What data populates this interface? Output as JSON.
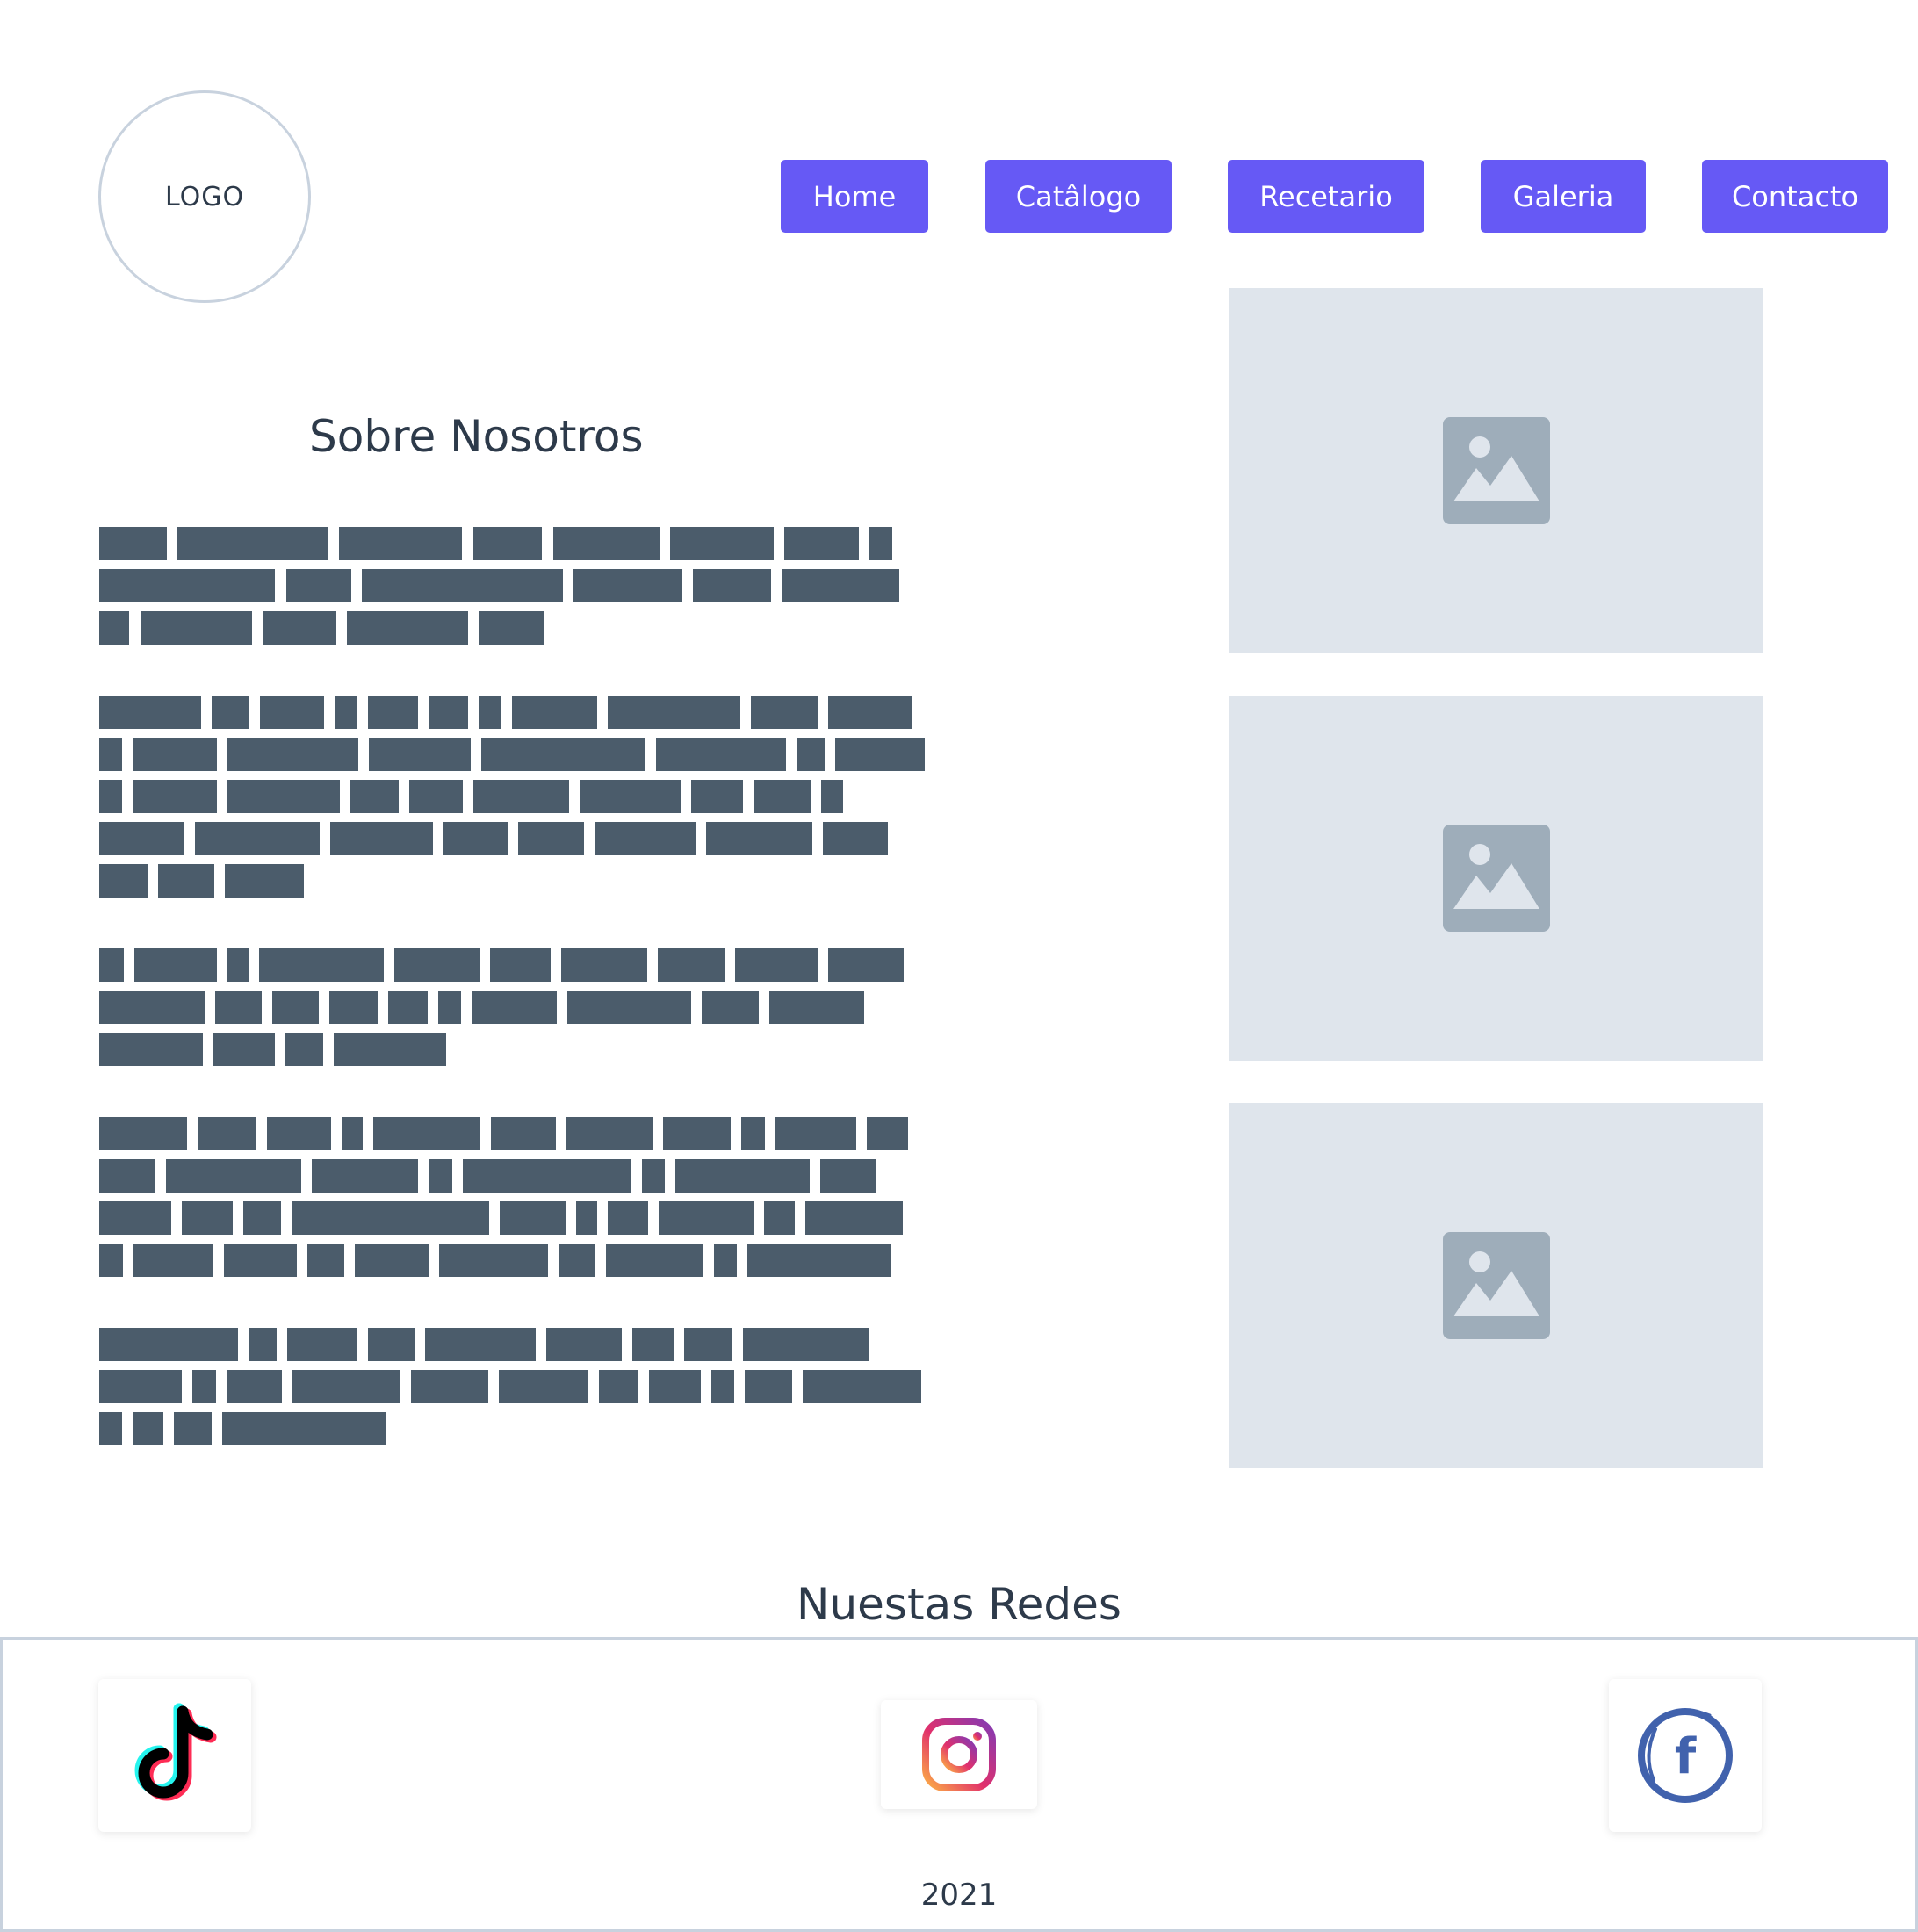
{
  "header": {
    "logo_label": "LOGO",
    "nav": [
      {
        "label": "Home"
      },
      {
        "label": "Catâlogo"
      },
      {
        "label": "Recetario"
      },
      {
        "label": "Galeria"
      },
      {
        "label": "Contacto"
      }
    ]
  },
  "main": {
    "title": "Sobre Nosotros",
    "image_icons": [
      "image-placeholder-icon",
      "image-placeholder-icon",
      "image-placeholder-icon"
    ]
  },
  "footer": {
    "title": "Nuestas Redes",
    "socials": [
      {
        "name": "tiktok-icon"
      },
      {
        "name": "instagram-icon"
      },
      {
        "name": "facebook-icon"
      }
    ],
    "year": "2021"
  },
  "colors": {
    "nav_button": "#6659f5",
    "placeholder_text": "#4b5c6b",
    "image_placeholder_bg": "#dfe5ec",
    "image_icon": "#9eadba"
  }
}
